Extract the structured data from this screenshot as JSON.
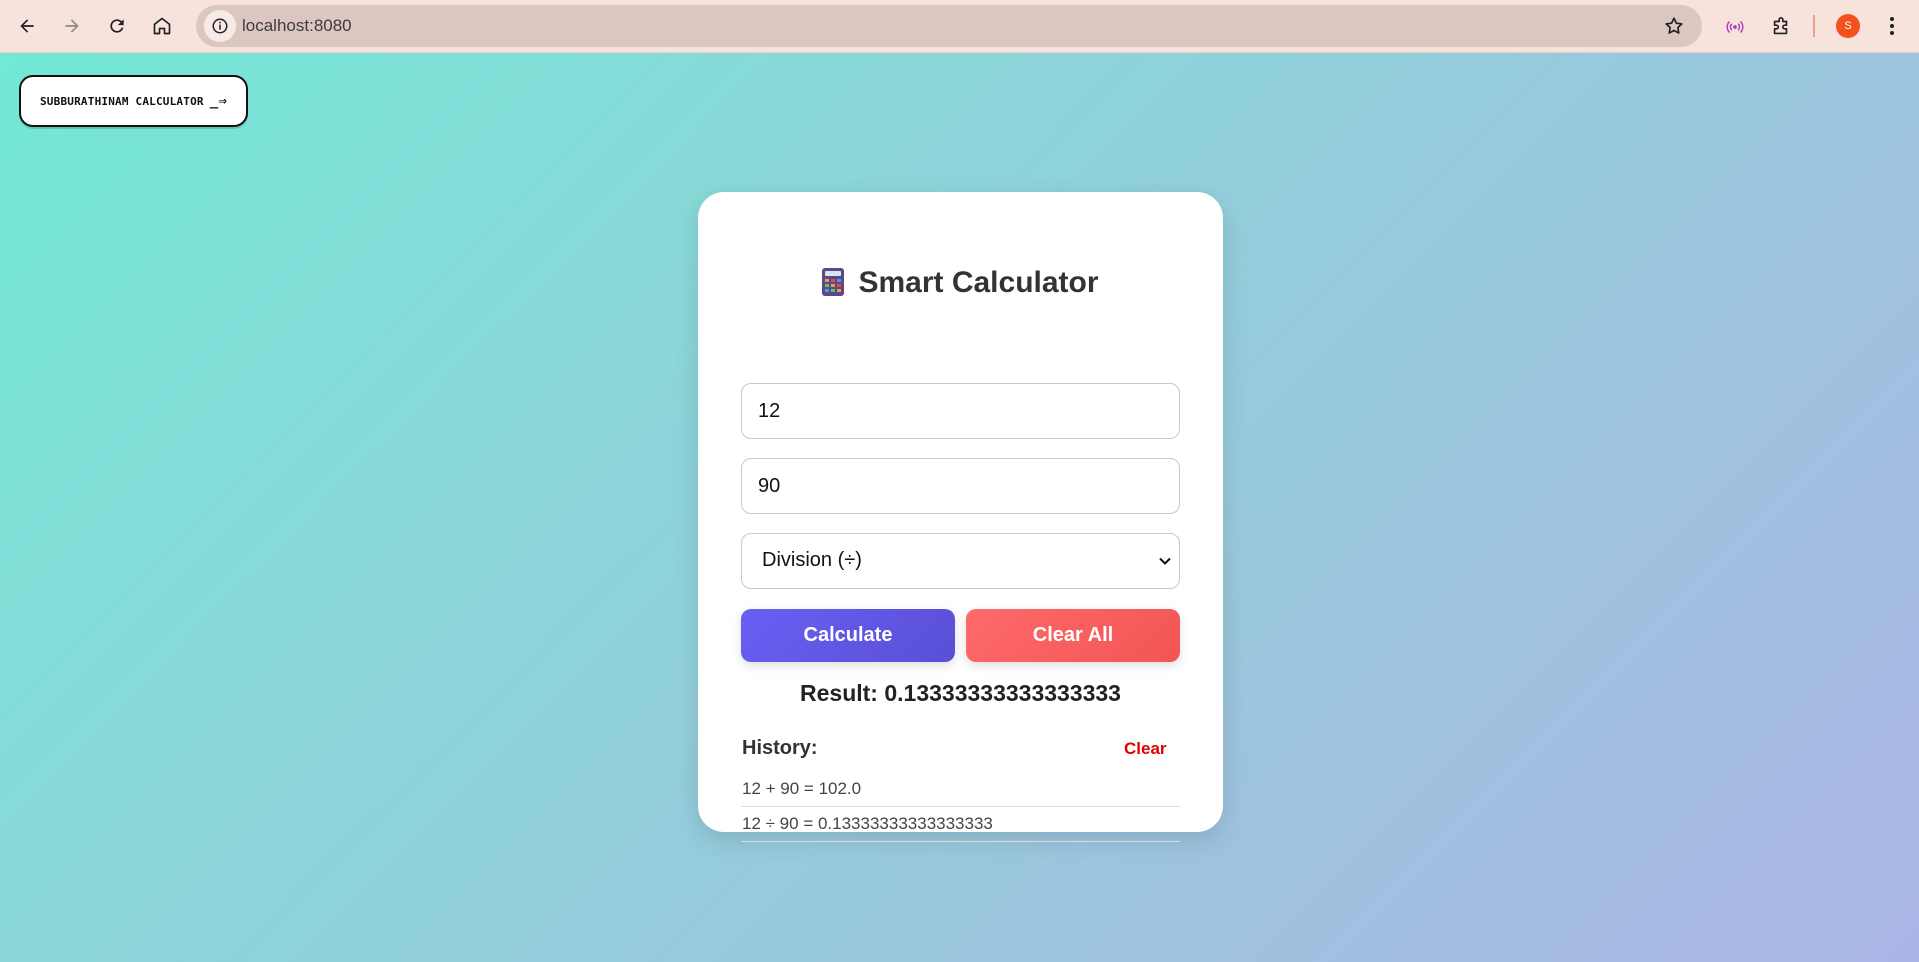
{
  "browser": {
    "url": "localhost:8080",
    "profile_initial": "S"
  },
  "page": {
    "brand_button_label": "SUBBURATHINAM CALCULATOR",
    "brand_button_arrow": "_⇒"
  },
  "calculator": {
    "title": "Smart Calculator",
    "number1_value": "12",
    "number2_value": "90",
    "operation_selected": "Division (÷)",
    "calculate_label": "Calculate",
    "clear_all_label": "Clear All",
    "result_text": "Result: 0.13333333333333333"
  },
  "history": {
    "heading": "History:",
    "clear_label": "Clear",
    "items": [
      "12 + 90 = 102.0",
      "12 ÷ 90 = 0.13333333333333333"
    ]
  },
  "colors": {
    "calculate_button": "#6a5ff3",
    "clear_all_button": "#ff6a6a",
    "history_clear": "#e00000",
    "profile": "#f4511e"
  }
}
